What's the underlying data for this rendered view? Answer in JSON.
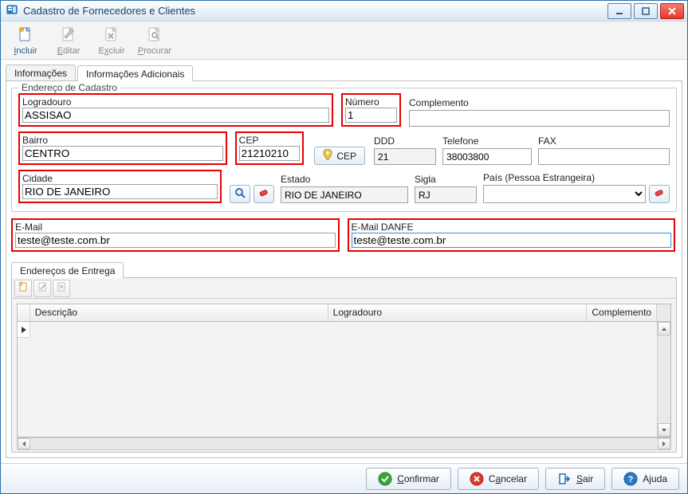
{
  "window": {
    "title": "Cadastro de Fornecedores e Clientes"
  },
  "toolbar": {
    "incluir": "Incluir",
    "editar": "Editar",
    "excluir": "Excluir",
    "procurar": "Procurar"
  },
  "tabs": {
    "info": "Informações",
    "info_adic": "Informações Adicionais"
  },
  "fieldset": {
    "legend": "Endereço de Cadastro"
  },
  "labels": {
    "logradouro": "Logradouro",
    "numero": "Número",
    "complemento": "Complemento",
    "bairro": "Bairro",
    "cep": "CEP",
    "ddd": "DDD",
    "telefone": "Telefone",
    "fax": "FAX",
    "cidade": "Cidade",
    "estado": "Estado",
    "sigla": "Sigla",
    "pais": "País (Pessoa Estrangeira)",
    "email": "E-Mail",
    "email_danfe": "E-Mail DANFE",
    "cep_btn": "CEP"
  },
  "values": {
    "logradouro": "ASSISAO",
    "numero": "1",
    "complemento": "",
    "bairro": "CENTRO",
    "cep": "21210210",
    "ddd": "21",
    "telefone": "38003800",
    "fax": "",
    "cidade": "RIO DE JANEIRO",
    "estado": "RIO DE JANEIRO",
    "sigla": "RJ",
    "pais": "",
    "email": "teste@teste.com.br",
    "email_danfe": "teste@teste.com.br"
  },
  "delivery": {
    "tab": "Endereços de Entrega",
    "columns": {
      "descricao": "Descrição",
      "logradouro": "Logradouro",
      "complemento": "Complemento"
    },
    "rows": []
  },
  "footer": {
    "confirmar": "Confirmar",
    "cancelar": "Cancelar",
    "sair": "Sair",
    "ajuda": "Ajuda"
  }
}
